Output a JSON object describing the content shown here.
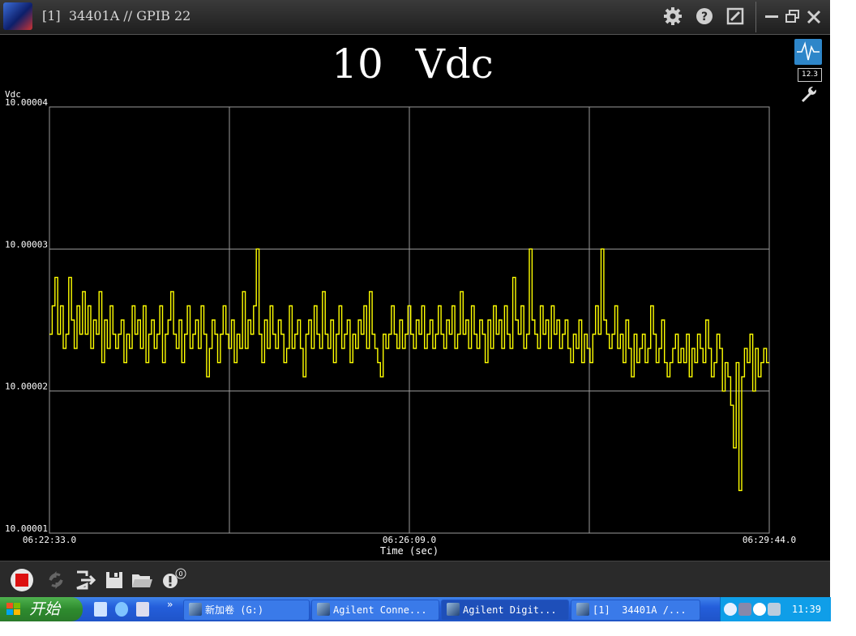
{
  "window": {
    "title": "[1]  34401A // GPIB 22",
    "title_icons": [
      "settings-gear-icon",
      "help-icon",
      "edit-box-icon",
      "minimize-icon",
      "restore-icon",
      "close-icon"
    ]
  },
  "display": {
    "reading": "10 Vdc",
    "side_badge": "12.3"
  },
  "chart_data": {
    "type": "line",
    "ylabel": "Vdc",
    "xlabel": "Time (sec)",
    "y_ticks": [
      "10.00004",
      "10.00003",
      "10.00002",
      "10.00001"
    ],
    "ylim": [
      10.00001,
      10.00004
    ],
    "x_ticks": [
      "06:22:33.0",
      "06:26:09.0",
      "06:29:44.0"
    ],
    "xlim": [
      "06:22:33.0",
      "06:29:44.0"
    ],
    "grid": true,
    "series": [
      {
        "color": "#ffff00",
        "values": [
          10.000024,
          10.000026,
          10.000028,
          10.000024,
          10.000026,
          10.000023,
          10.000024,
          10.000028,
          10.000025,
          10.000023,
          10.000026,
          10.000024,
          10.000027,
          10.000024,
          10.000026,
          10.000023,
          10.000025,
          10.000024,
          10.000027,
          10.000022,
          10.000025,
          10.000023,
          10.000026,
          10.000024,
          10.000023,
          10.000024,
          10.000025,
          10.000022,
          10.000024,
          10.000023,
          10.000026,
          10.000024,
          10.000025,
          10.000023,
          10.000026,
          10.000022,
          10.000024,
          10.000025,
          10.000023,
          10.000024,
          10.000026,
          10.000022,
          10.000024,
          10.000025,
          10.000027,
          10.000024,
          10.000023,
          10.000025,
          10.000022,
          10.000024,
          10.000026,
          10.000023,
          10.000024,
          10.000025,
          10.000023,
          10.000026,
          10.000024,
          10.000021,
          10.000023,
          10.000025,
          10.000024,
          10.000022,
          10.000024,
          10.000026,
          10.000024,
          10.000023,
          10.000025,
          10.000022,
          10.000024,
          10.000023,
          10.000027,
          10.000023,
          10.000025,
          10.000024,
          10.000026,
          10.00003,
          10.000024,
          10.000022,
          10.000025,
          10.000023,
          10.000026,
          10.000024,
          10.000023,
          10.000025,
          10.000024,
          10.000022,
          10.000023,
          10.000026,
          10.000023,
          10.000024,
          10.000025,
          10.000023,
          10.000021,
          10.000024,
          10.000025,
          10.000023,
          10.000026,
          10.000024,
          10.000023,
          10.000027,
          10.000024,
          10.000023,
          10.000025,
          10.000022,
          10.000024,
          10.000026,
          10.000023,
          10.000024,
          10.000025,
          10.000022,
          10.000024,
          10.000023,
          10.000025,
          10.000024,
          10.000026,
          10.000023,
          10.000027,
          10.000024,
          10.000023,
          10.000022,
          10.000021,
          10.000024,
          10.000023,
          10.000024,
          10.000026,
          10.000024,
          10.000023,
          10.000025,
          10.000023,
          10.000024,
          10.000026,
          10.000024,
          10.000023,
          10.000025,
          10.000024,
          10.000026,
          10.000023,
          10.000024,
          10.000025,
          10.000023,
          10.000024,
          10.000026,
          10.000024,
          10.000023,
          10.000025,
          10.000024,
          10.000026,
          10.000023,
          10.000024,
          10.000027,
          10.000024,
          10.000025,
          10.000023,
          10.000026,
          10.000024,
          10.000023,
          10.000025,
          10.000024,
          10.000022,
          10.000025,
          10.000023,
          10.000026,
          10.000024,
          10.000025,
          10.000023,
          10.000026,
          10.000024,
          10.000023,
          10.000028,
          10.000025,
          10.000024,
          10.000026,
          10.000023,
          10.000024,
          10.00003,
          10.000025,
          10.000024,
          10.000023,
          10.000026,
          10.000024,
          10.000025,
          10.000023,
          10.000026,
          10.000024,
          10.000025,
          10.000023,
          10.000024,
          10.000025,
          10.000023,
          10.000022,
          10.000024,
          10.000023,
          10.000025,
          10.000022,
          10.000024,
          10.000023,
          10.000022,
          10.000024,
          10.000026,
          10.000024,
          10.00003,
          10.000025,
          10.000024,
          10.000023,
          10.000024,
          10.000026,
          10.000023,
          10.000024,
          10.000022,
          10.000025,
          10.000023,
          10.000021,
          10.000024,
          10.000022,
          10.000023,
          10.000024,
          10.000022,
          10.000023,
          10.000026,
          10.000024,
          10.000022,
          10.000023,
          10.000025,
          10.000022,
          10.000021,
          10.000022,
          10.000023,
          10.000024,
          10.000022,
          10.000023,
          10.000022,
          10.000024,
          10.000021,
          10.000023,
          10.000022,
          10.000024,
          10.000023,
          10.000022,
          10.000025,
          10.000023,
          10.000021,
          10.000022,
          10.000024,
          10.000023,
          10.00002,
          10.000022,
          10.000021,
          10.000019,
          10.000016,
          10.000022,
          10.000013,
          10.000021,
          10.000023,
          10.000022,
          10.000024,
          10.00002,
          10.000023,
          10.000021,
          10.000022,
          10.000023,
          10.000022
        ]
      }
    ]
  },
  "bottom_toolbar": {
    "icons": [
      "record-stop-icon",
      "refresh-icon",
      "export-icon",
      "save-icon",
      "open-folder-icon",
      "alert-counter-icon"
    ],
    "alert_count": "0"
  },
  "taskbar": {
    "start_label": "开始",
    "chevron": "»",
    "items": [
      {
        "label": "新加卷 (G:)",
        "active": false
      },
      {
        "label": "Agilent Conne...",
        "active": false
      },
      {
        "label": "Agilent Digit...",
        "active": true
      },
      {
        "label": "[1]  34401A /...",
        "active": false
      }
    ],
    "clock": "11:39"
  }
}
